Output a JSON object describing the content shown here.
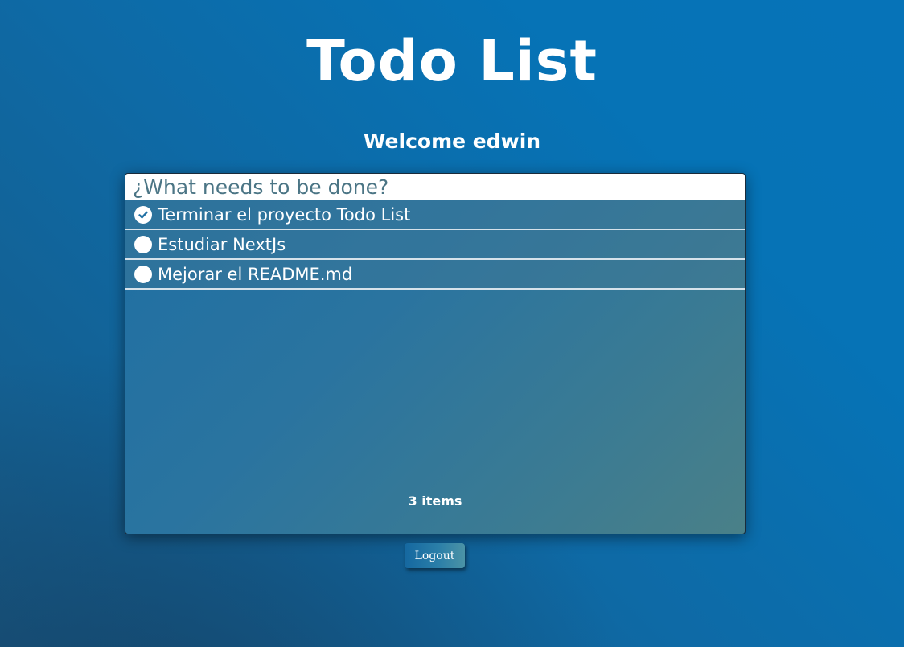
{
  "header": {
    "title": "Todo List",
    "welcome": "Welcome edwin"
  },
  "todo": {
    "input": {
      "placeholder": "¿What needs to be done?",
      "value": ""
    },
    "items": [
      {
        "text": "Terminar el proyecto Todo List",
        "completed": true
      },
      {
        "text": "Estudiar NextJs",
        "completed": false
      },
      {
        "text": "Mejorar el README.md",
        "completed": false
      }
    ],
    "count_label": "3 items"
  },
  "actions": {
    "logout_label": "Logout"
  },
  "icons": {
    "completed": "check-circle-icon",
    "pending": "empty-circle-icon"
  },
  "colors": {
    "background": "#0e6aa6",
    "check_icon": "#1f6fa3",
    "text": "#ffffff"
  }
}
